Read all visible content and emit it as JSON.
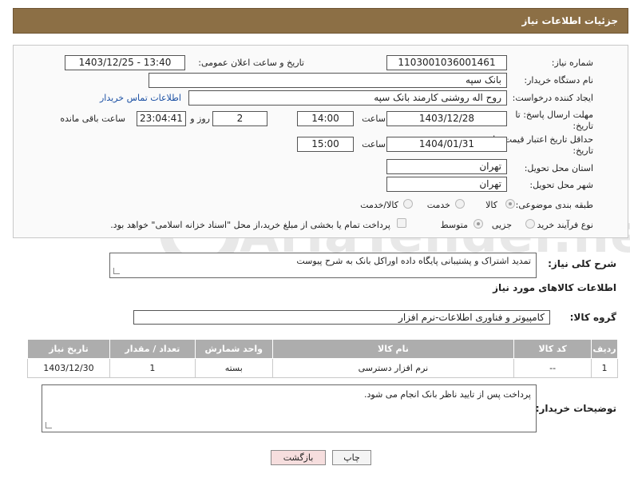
{
  "header": {
    "title": "جزئیات اطلاعات نیاز"
  },
  "form": {
    "need_number_label": "شماره نیاز:",
    "need_number": "1103001036001461",
    "announce_label": "تاریخ و ساعت اعلان عمومی:",
    "announce_value": "1403/12/25 - 13:40",
    "buyer_org_label": "نام دستگاه خریدار:",
    "buyer_org": "بانک سپه",
    "creator_label": "ایجاد کننده درخواست:",
    "creator": "روح اله روشنی کارمند بانک سپه",
    "contact_link": "اطلاعات تماس خریدار",
    "reply_deadline_label": "مهلت ارسال پاسخ: تا",
    "reply_deadline_label2": "تاریخ:",
    "reply_date": "1403/12/28",
    "time_label": "ساعت",
    "reply_time": "14:00",
    "days_value": "2",
    "days_label": "روز و",
    "remaining_time": "23:04:41",
    "remaining_label": "ساعت باقی مانده",
    "price_deadline_label": "حداقل تاریخ اعتبار قیمت: تا",
    "price_deadline_label2": "تاریخ:",
    "price_date": "1404/01/31",
    "price_time": "15:00",
    "province_label": "استان محل تحویل:",
    "province": "تهران",
    "city_label": "شهر محل تحویل:",
    "city": "تهران",
    "category_label": "طبقه بندی موضوعی:",
    "category_options": [
      "کالا",
      "خدمت",
      "کالا/خدمت"
    ],
    "process_label": "نوع فرآیند خرید :",
    "process_options": [
      "جزیی",
      "متوسط"
    ],
    "payment_note": "پرداخت تمام یا بخشی از مبلغ خرید،از محل \"اسناد خزانه اسلامی\" خواهد بود."
  },
  "description": {
    "label": "شرح کلی نیاز:",
    "text": "تمدید اشتراک و پشتیبانی پایگاه داده اوراکل بانک به شرح پیوست"
  },
  "goods_section": {
    "title": "اطلاعات کالاهای مورد نیاز",
    "group_label": "گروه کالا:",
    "group_value": "کامپیوتر و فناوری اطلاعات-نرم افزار"
  },
  "table": {
    "headers": [
      "ردیف",
      "کد کالا",
      "نام کالا",
      "واحد شمارش",
      "تعداد / مقدار",
      "تاریخ نیاز"
    ],
    "rows": [
      [
        "1",
        "--",
        "نرم افزار دسترسی",
        "بسته",
        "1",
        "1403/12/30"
      ]
    ]
  },
  "buyer_notes": {
    "label": "توضیحات خریدار:",
    "text": "پرداخت پس از تایید ناظر بانک انجام می شود."
  },
  "buttons": {
    "print": "چاپ",
    "back": "بازگشت"
  },
  "watermark": {
    "text": "AriaTender.net"
  },
  "colors": {
    "header": "#8c6f45",
    "table_header": "#adadad",
    "link": "#1a4fa3",
    "back_button": "#f6dede"
  }
}
